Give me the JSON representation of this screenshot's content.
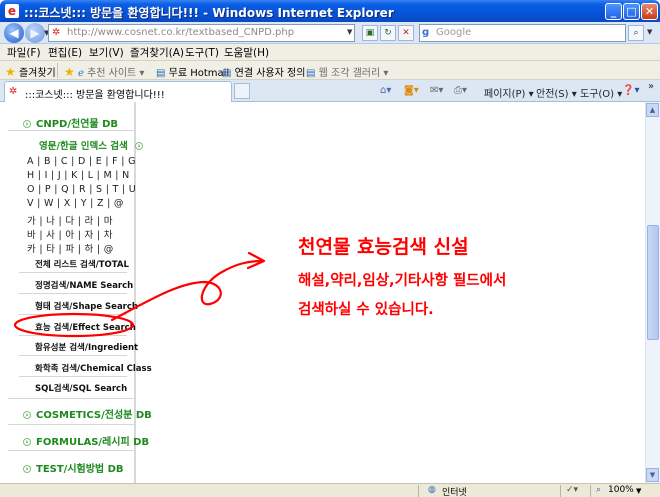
{
  "window": {
    "title": ":::코스넷::: 방문을 환영합니다!!! - Windows Internet Explorer",
    "buttons": {
      "minimize": "_",
      "maximize": "□",
      "close": "✕"
    }
  },
  "address_bar": {
    "url": "http://www.cosnet.co.kr/textbased_CNPD.php",
    "search_placeholder": "Google",
    "back_glyph": "◀",
    "forward_glyph": "▶"
  },
  "menubar": {
    "items": [
      "파일(F)",
      "편집(E)",
      "보기(V)",
      "즐겨찾기(A)",
      "도구(T)",
      "도움말(H)"
    ]
  },
  "links_bar": {
    "favorites": "즐겨찾기",
    "items": [
      "추천 사이트 ▾",
      "무료 Hotmail",
      "연결 사용자 정의",
      "웹 조각 갤러리 ▾"
    ]
  },
  "tab": {
    "title": ":::코스넷::: 방문을 환영합니다!!!",
    "toolbar": [
      "페이지(P) ▾",
      "안전(S) ▾",
      "도구(O) ▾"
    ]
  },
  "sidebar": {
    "cnpd": "CNPD/천연물 DB",
    "search_title": "영문/한글 인덱스 검색",
    "alpha_rows": [
      "A | B | C | D | E | F | G",
      "H | I | J | K | L | M | N",
      "O | P | Q | R | S | T | U",
      "V | W | X | Y | Z | @",
      "가 | 나 | 다 | 라 | 마",
      "바 | 사 | 아 | 자 | 차",
      "카 | 타 | 파 | 하 | @"
    ],
    "items": [
      "전체 리스트 검색/TOTAL",
      "정명검색/NAME Search",
      "형태 검색/Shape Search",
      "효능 검색/Effect Search",
      "함유성분 검색/Ingredient",
      "화학족 검색/Chemical Class",
      "SQL검색/SQL Search"
    ],
    "db_links": [
      "COSMETICS/전성분 DB",
      "FORMULAS/레시피 DB",
      "TEST/시험방법 DB"
    ]
  },
  "annotation": {
    "headline": "천연물 효능검색 신설",
    "line1": "해설,약리,임상,기타사항 필드에서",
    "line2": "검색하실 수 있습니다.",
    "color": "#ff0000"
  },
  "statusbar": {
    "zone": "인터넷",
    "zoom": "100%"
  }
}
